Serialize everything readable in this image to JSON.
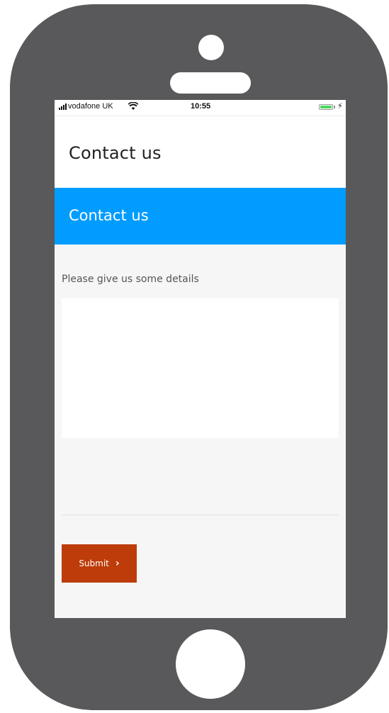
{
  "status_bar": {
    "carrier": "vodafone UK",
    "time": "10:55",
    "charging_symbol": "⚡",
    "battery_level": 1.0,
    "battery_color": "#4cd964"
  },
  "header": {
    "title": "Contact us"
  },
  "banner": {
    "title": "Contact us",
    "color": "#009cff"
  },
  "form": {
    "details_label": "Please give us some details",
    "details_value": "",
    "submit_label": "Submit",
    "submit_icon": "chevron-right-icon",
    "submit_color": "#bd3c0a"
  },
  "icons": {
    "signal": "signal-icon",
    "wifi": "wifi-icon",
    "battery": "battery-icon"
  }
}
